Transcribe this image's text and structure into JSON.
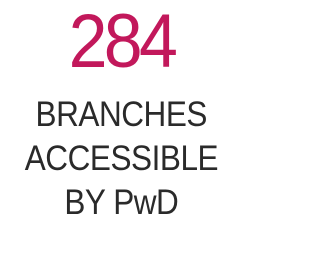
{
  "stat": {
    "number": "284",
    "label_lines": [
      "BRANCHES",
      "ACCESSIBLE",
      "BY PwD"
    ]
  },
  "colors": {
    "number": "#c2185b",
    "label": "#2a2a2a",
    "background": "#ffffff"
  }
}
